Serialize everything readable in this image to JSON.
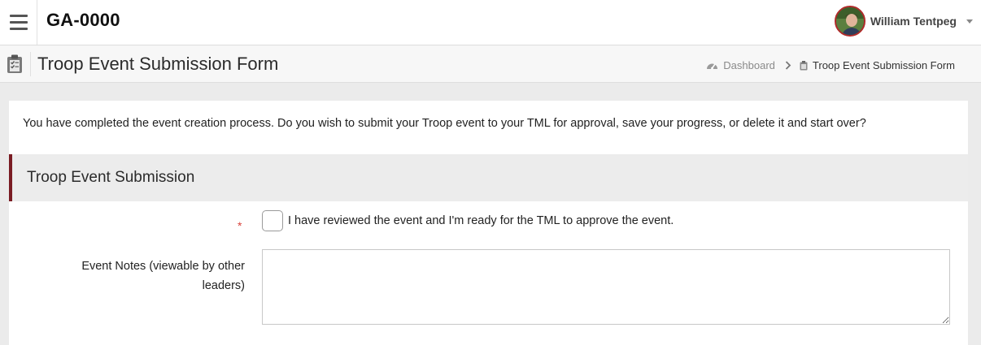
{
  "topbar": {
    "org_code": "GA-0000",
    "user_name": "William Tentpeg"
  },
  "page": {
    "title": "Troop Event Submission Form",
    "breadcrumb": {
      "home": "Dashboard",
      "current": "Troop Event Submission Form"
    }
  },
  "form": {
    "intro_text": "You have completed the event creation process. Do you wish to submit your Troop event to your TML for approval, save your progress, or delete it and start over?",
    "section_title": "Troop Event Submission",
    "required_mark": "*",
    "review_checkbox_label": "I have reviewed the event and I'm ready for the TML to approve the event.",
    "review_checked": false,
    "notes_label": "Event Notes (viewable by other leaders)",
    "notes_value": ""
  },
  "colors": {
    "section_accent": "#7a1c23",
    "required": "#d9423b",
    "avatar_ring": "#b02a2a"
  }
}
